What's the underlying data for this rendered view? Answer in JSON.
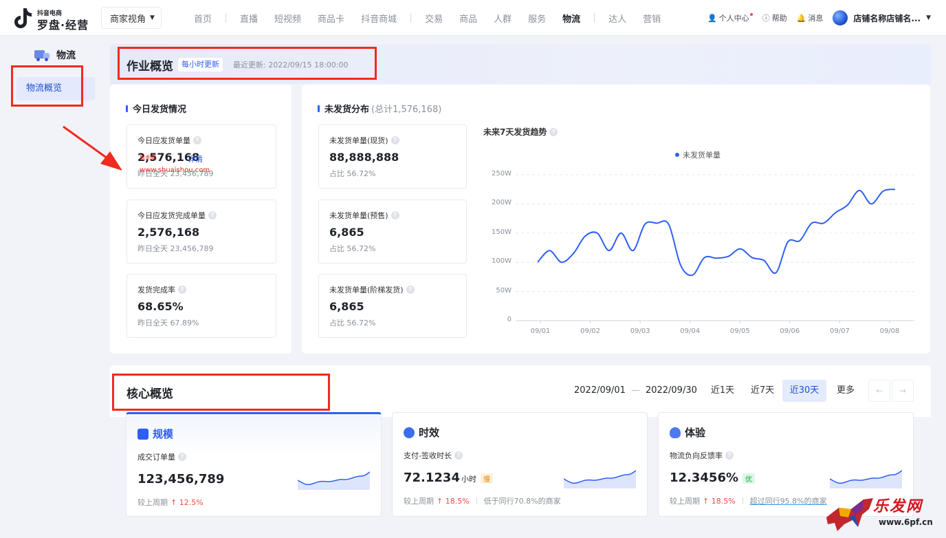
{
  "app": {
    "brand_small": "抖音电商",
    "brand_big": "罗盘·经营",
    "role_select": "商家视角"
  },
  "nav": {
    "items": [
      "首页",
      "直播",
      "短视频",
      "商品卡",
      "抖音商城",
      "交易",
      "商品",
      "人群",
      "服务",
      "物流",
      "达人",
      "营销"
    ],
    "active": "物流"
  },
  "nav_right": {
    "personal": "个人中心",
    "help": "帮助",
    "messages": "消息",
    "store": "店铺名称店铺名..."
  },
  "sidebar": {
    "header": "物流",
    "item": "物流概览"
  },
  "ops": {
    "title": "作业概览",
    "tag": "每小时更新",
    "updated": "最近更新: 2022/09/15 18:00:00"
  },
  "today": {
    "title": "今日发货情况",
    "metrics": [
      {
        "label": "今日应发货单量",
        "value": "2,576,168",
        "link": "详情",
        "sub": "昨日全天 23,456,789"
      },
      {
        "label": "今日应发货完成单量",
        "value": "2,576,168",
        "sub": "昨日全天 23,456,789"
      },
      {
        "label": "发货完成率",
        "value": "68.65%",
        "sub": "昨日全天 67.89%"
      }
    ]
  },
  "watermark": {
    "url": "www.shuaishou.com",
    "small": "甩手网"
  },
  "unshipped": {
    "title": "未发货分布",
    "total": "(总计1,576,168)",
    "metrics": [
      {
        "label": "未发货单量(现货)",
        "value": "88,888,888",
        "sub": "占比 56.72%"
      },
      {
        "label": "未发货单量(预售)",
        "value": "6,865",
        "sub": "占比 56.72%"
      },
      {
        "label": "未发货单量(阶梯发货)",
        "value": "6,865",
        "sub": "占比 56.72%"
      }
    ]
  },
  "chart_data": {
    "type": "line",
    "title": "未来7天发货趋势",
    "series": [
      {
        "name": "未发货单量",
        "values": [
          100,
          120,
          100,
          115,
          145,
          150,
          120,
          150,
          120,
          165,
          167,
          165,
          95,
          78,
          108,
          107,
          110,
          123,
          108,
          103,
          82,
          135,
          137,
          167,
          167,
          185,
          198,
          223,
          200,
          222,
          225
        ]
      }
    ],
    "x_ticks": [
      "09/01",
      "09/02",
      "09/03",
      "09/04",
      "09/05",
      "09/06",
      "09/07",
      "09/08"
    ],
    "y_ticks": [
      "0",
      "50W",
      "100W",
      "150W",
      "200W",
      "250W"
    ],
    "ylim": [
      0,
      250
    ],
    "grid": true,
    "legend": "top-center"
  },
  "core": {
    "title": "核心概览",
    "date_from": "2022/09/01",
    "date_sep": "—",
    "date_to": "2022/09/30",
    "ranges": [
      "近1天",
      "近7天",
      "近30天",
      "更多"
    ],
    "active_range": "近30天",
    "prev": "←",
    "next": "→",
    "cards": [
      {
        "title": "规模",
        "label": "成交订单量",
        "value": "123,456,789",
        "unit": "",
        "badge": "",
        "cmp": "较上周期",
        "delta": "↑ 12.5%",
        "extra": "",
        "icon_color": "#2d5ff2"
      },
      {
        "title": "时效",
        "label": "支付-签收时长",
        "value": "72.1234",
        "unit": "小时",
        "badge": "慢",
        "cmp": "较上周期",
        "delta": "↑ 18.5%",
        "extra": "低于同行70.8%的商家",
        "icon_color": "#3c6ee8"
      },
      {
        "title": "体验",
        "label": "物流负向反馈率",
        "value": "12.3456%",
        "unit": "",
        "badge": "优",
        "cmp": "较上周期",
        "delta": "↑ 18.5%",
        "extra": "超过同行95.8%的商家",
        "icon_color": "#4d7bef"
      }
    ]
  },
  "footer_logo": {
    "cn": "乐发网",
    "url": "www.6pf.cn"
  }
}
